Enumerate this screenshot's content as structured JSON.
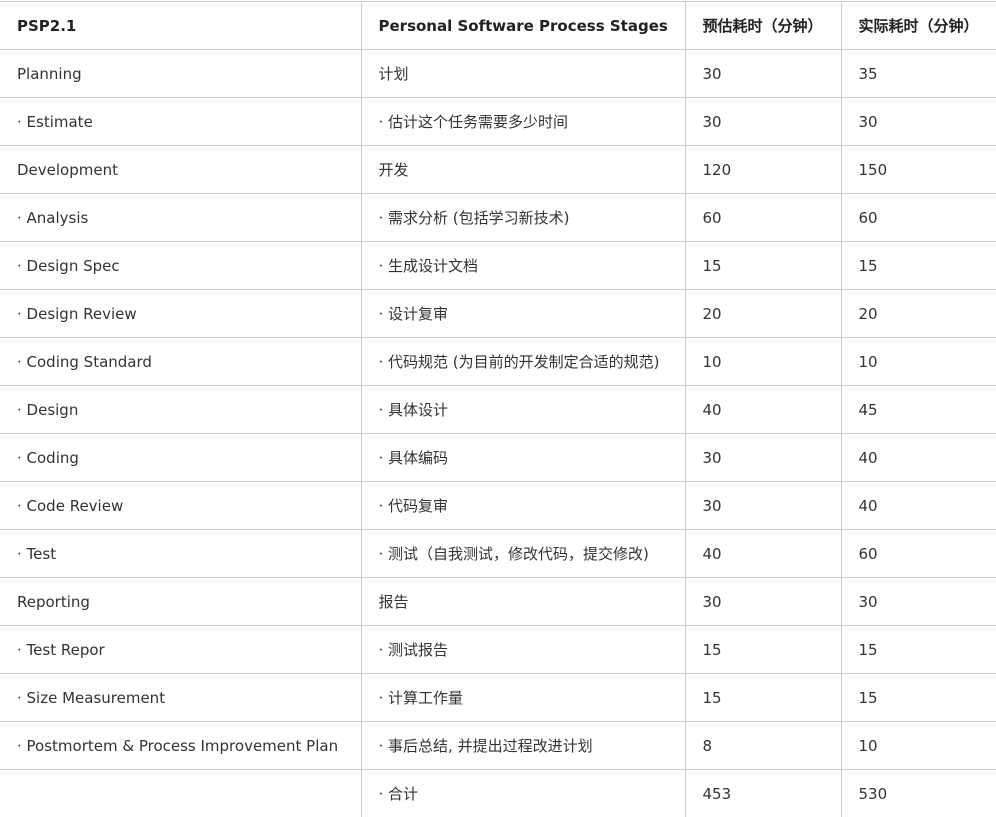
{
  "table": {
    "headers": [
      "PSP2.1",
      "Personal Software Process Stages",
      "预估耗时（分钟）",
      "实际耗时（分钟）"
    ],
    "rows": [
      [
        "Planning",
        "计划",
        "30",
        "35"
      ],
      [
        "· Estimate",
        "· 估计这个任务需要多少时间",
        "30",
        "30"
      ],
      [
        "Development",
        "开发",
        "120",
        "150"
      ],
      [
        "· Analysis",
        "· 需求分析 (包括学习新技术)",
        "60",
        "60"
      ],
      [
        "· Design Spec",
        "· 生成设计文档",
        "15",
        "15"
      ],
      [
        "· Design Review",
        "· 设计复审",
        "20",
        "20"
      ],
      [
        "· Coding Standard",
        "· 代码规范 (为目前的开发制定合适的规范)",
        "10",
        "10"
      ],
      [
        "· Design",
        "· 具体设计",
        "40",
        "45"
      ],
      [
        "· Coding",
        "· 具体编码",
        "30",
        "40"
      ],
      [
        "· Code Review",
        "· 代码复审",
        "30",
        "40"
      ],
      [
        "· Test",
        "· 测试（自我测试，修改代码，提交修改)",
        "40",
        "60"
      ],
      [
        "Reporting",
        "报告",
        "30",
        "30"
      ],
      [
        "· Test Repor",
        "· 测试报告",
        "15",
        "15"
      ],
      [
        "· Size Measurement",
        "· 计算工作量",
        "15",
        "15"
      ],
      [
        "· Postmortem & Process Improvement Plan",
        "· 事后总结, 并提出过程改进计划",
        "8",
        "10"
      ],
      [
        "",
        "· 合计",
        "453",
        "530"
      ]
    ]
  }
}
